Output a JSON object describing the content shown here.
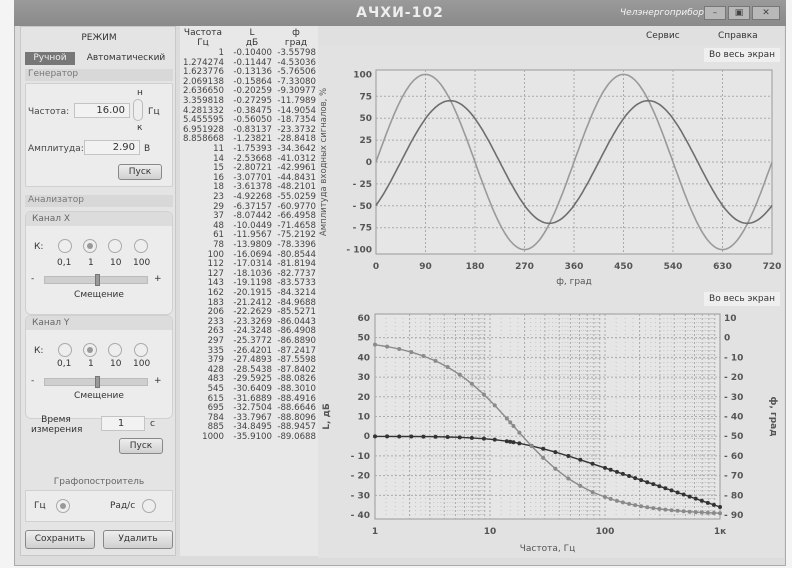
{
  "window": {
    "title": "АЧХИ-102",
    "brand": "Челэнергоприбор",
    "menu": [
      "Сервис",
      "Справка"
    ]
  },
  "left": {
    "mode_title": "РЕЖИМ",
    "mode_tabs": [
      {
        "label": "Ручной",
        "active": true
      },
      {
        "label": "Автоматический",
        "active": false
      }
    ],
    "generator": {
      "title": "Генератор",
      "freq_label": "Частота:",
      "freq_value": "16.00",
      "freq_unit": "Гц",
      "spin_up": "н",
      "spin_down": "к",
      "amp_label": "Амплитуда:",
      "amp_value": "2.90",
      "amp_unit": "В",
      "start": "Пуск"
    },
    "analyzer": {
      "title": "Анализатор",
      "channel_x": {
        "title": "Канал X",
        "k_label": "К:",
        "options": [
          "0,1",
          "1",
          "10",
          "100"
        ],
        "selected": "1",
        "offset_label": "Смещение",
        "minus": "-",
        "plus": "+",
        "offset_value": 0.5
      },
      "channel_y": {
        "title": "Канал Y",
        "k_label": "К:",
        "options": [
          "0,1",
          "1",
          "10",
          "100"
        ],
        "selected": "1",
        "offset_label": "Смещение",
        "minus": "-",
        "plus": "+",
        "offset_value": 0.5
      },
      "time_label_1": "Время",
      "time_label_2": "измерения",
      "time_value": "1",
      "time_unit": "с",
      "start": "Пуск"
    },
    "plotter": {
      "title": "Графопостроитель",
      "hz": "Гц",
      "rad": "Рад/с",
      "selected": "Гц"
    },
    "save": "Сохранить",
    "delete": "Удалить"
  },
  "table": {
    "headers": [
      [
        "Частота",
        "Гц"
      ],
      [
        "L",
        "дБ"
      ],
      [
        "ф",
        "град"
      ]
    ],
    "rows": [
      [
        "1",
        "-0.10400",
        "-3.55798"
      ],
      [
        "1.274274",
        "-0.11447",
        "-4.53036"
      ],
      [
        "1.623776",
        "-0.13136",
        "-5.76506"
      ],
      [
        "2.069138",
        "-0.15864",
        "-7.33080"
      ],
      [
        "2.636650",
        "-0.20259",
        "-9.30977"
      ],
      [
        "3.359818",
        "-0.27295",
        "-11.7989"
      ],
      [
        "4.281332",
        "-0.38475",
        "-14.9054"
      ],
      [
        "5.455595",
        "-0.56050",
        "-18.7354"
      ],
      [
        "6.951928",
        "-0.83137",
        "-23.3732"
      ],
      [
        "8.858668",
        "-1.23821",
        "-28.8418"
      ],
      [
        "11",
        "-1.75393",
        "-34.3642"
      ],
      [
        "14",
        "-2.53668",
        "-41.0312"
      ],
      [
        "15",
        "-2.80721",
        "-42.9961"
      ],
      [
        "16",
        "-3.07701",
        "-44.8431"
      ],
      [
        "18",
        "-3.61378",
        "-48.2101"
      ],
      [
        "23",
        "-4.92268",
        "-55.0259"
      ],
      [
        "29",
        "-6.37157",
        "-60.9770"
      ],
      [
        "37",
        "-8.07442",
        "-66.4958"
      ],
      [
        "48",
        "-10.0449",
        "-71.4658"
      ],
      [
        "61",
        "-11.9567",
        "-75.2192"
      ],
      [
        "78",
        "-13.9809",
        "-78.3396"
      ],
      [
        "100",
        "-16.0694",
        "-80.8544"
      ],
      [
        "112",
        "-17.0314",
        "-81.8194"
      ],
      [
        "127",
        "-18.1036",
        "-82.7737"
      ],
      [
        "143",
        "-19.1198",
        "-83.5733"
      ],
      [
        "162",
        "-20.1915",
        "-84.3214"
      ],
      [
        "183",
        "-21.2412",
        "-84.9688"
      ],
      [
        "206",
        "-22.2629",
        "-85.5271"
      ],
      [
        "233",
        "-23.3269",
        "-86.0443"
      ],
      [
        "263",
        "-24.3248",
        "-86.4908"
      ],
      [
        "297",
        "-25.3772",
        "-86.8890"
      ],
      [
        "335",
        "-26.4201",
        "-87.2417"
      ],
      [
        "379",
        "-27.4893",
        "-87.5598"
      ],
      [
        "428",
        "-28.5438",
        "-87.8402"
      ],
      [
        "483",
        "-29.5925",
        "-88.0826"
      ],
      [
        "545",
        "-30.6409",
        "-88.3010"
      ],
      [
        "615",
        "-31.6889",
        "-88.4916"
      ],
      [
        "695",
        "-32.7504",
        "-88.6646"
      ],
      [
        "784",
        "-33.7967",
        "-88.8096"
      ],
      [
        "885",
        "-34.8495",
        "-88.9457"
      ],
      [
        "1000",
        "-35.9100",
        "-89.0688"
      ]
    ]
  },
  "fullscreen_label": "Во весь экран",
  "chart_data": [
    {
      "type": "line",
      "xlabel": "ф, град",
      "ylabel": "Амплитуда входных сигналов, %",
      "xlim": [
        0,
        720
      ],
      "ylim": [
        -105,
        105
      ],
      "xticks": [
        "0",
        "90",
        "180",
        "270",
        "360",
        "450",
        "540",
        "630",
        "720"
      ],
      "yticks": [
        "100",
        "75",
        "50",
        "25",
        "0",
        "- 25",
        "- 50",
        "- 75",
        "- 100"
      ],
      "grid": true,
      "series": [
        {
          "amplitude": 100,
          "phase_shift_deg": 0,
          "color": "#9a9a9a"
        },
        {
          "amplitude": 70,
          "phase_shift_deg": -45,
          "color": "#6e6e6e"
        }
      ]
    },
    {
      "type": "line",
      "xscale": "log",
      "xlabel": "Частота, Гц",
      "ylabel": "L, дБ",
      "ylabel_right": "ф, град",
      "xlim": [
        1,
        1000
      ],
      "ylim": [
        -42,
        62
      ],
      "ylim_right": [
        -92,
        12
      ],
      "xticks": [
        "1",
        "10",
        "100",
        "1к"
      ],
      "yticks": [
        "60",
        "50",
        "40",
        "30",
        "20",
        "10",
        "0",
        "- 10",
        "- 20",
        "- 30",
        "- 40"
      ],
      "yticks_right": [
        "10",
        "0",
        "- 10",
        "- 20",
        "- 30",
        "- 40",
        "- 50",
        "- 60",
        "- 70",
        "- 80",
        "- 90"
      ],
      "grid": true,
      "series": [
        {
          "name": "L",
          "axis": "left",
          "color": "#333333",
          "source": "table L"
        },
        {
          "name": "ф",
          "axis": "right",
          "color": "#8a8a8a",
          "source": "table ф"
        }
      ]
    }
  ]
}
